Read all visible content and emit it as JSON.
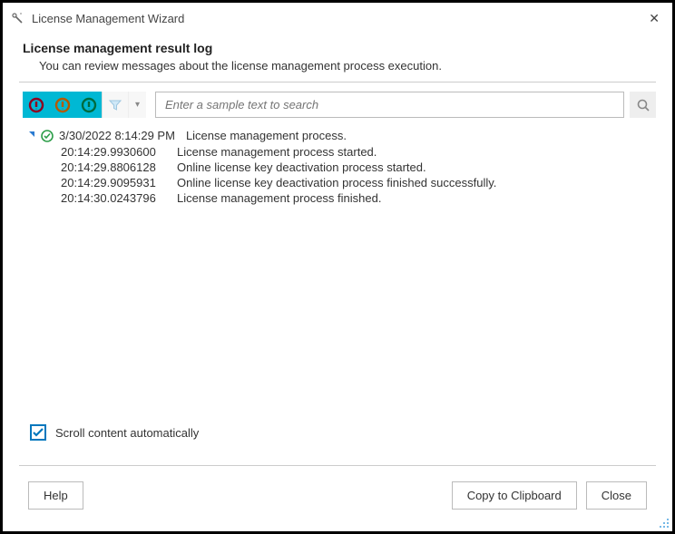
{
  "window": {
    "title": "License Management Wizard"
  },
  "header": {
    "title": "License management result log",
    "subtitle": "You can review messages about the license management process execution."
  },
  "search": {
    "placeholder": "Enter a sample text to search"
  },
  "log": {
    "parent_timestamp": "3/30/2022 8:14:29 PM",
    "parent_message": "License management process.",
    "rows": [
      {
        "ts": "20:14:29.9930600",
        "msg": "License management process started."
      },
      {
        "ts": "20:14:29.8806128",
        "msg": "Online license key deactivation process started."
      },
      {
        "ts": "20:14:29.9095931",
        "msg": "Online license key deactivation process finished successfully."
      },
      {
        "ts": "20:14:30.0243796",
        "msg": "License management process finished."
      }
    ]
  },
  "scroll_auto": {
    "label": "Scroll content automatically",
    "checked": true
  },
  "buttons": {
    "help": "Help",
    "copy": "Copy to Clipboard",
    "close": "Close"
  }
}
